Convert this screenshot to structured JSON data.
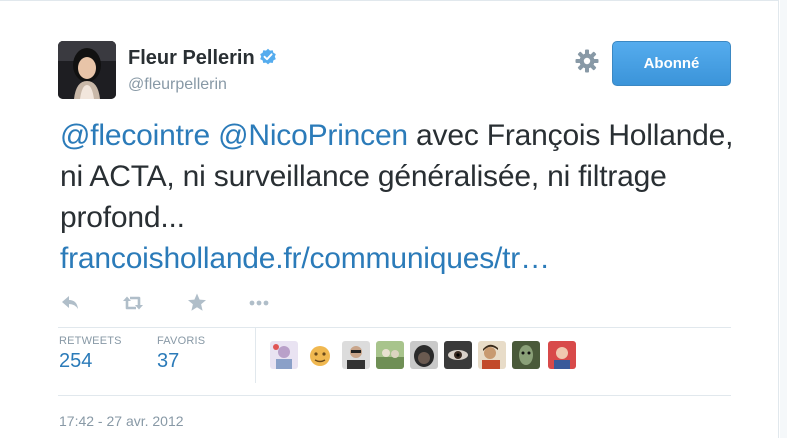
{
  "user": {
    "name": "Fleur Pellerin",
    "handle": "@fleurpellerin",
    "verified": true
  },
  "follow_button": {
    "label": "Abonné"
  },
  "tweet": {
    "mention_1": "@flecointre",
    "mention_2": "@NicoPrincen",
    "text_after_mentions": " avec François Hollande, ni ACTA, ni surveillance généralisée, ni filtrage profond...",
    "link_text": "francoishollande.fr/communiques/tr…"
  },
  "actions": [
    {
      "icon": "reply-icon"
    },
    {
      "icon": "retweet-icon"
    },
    {
      "icon": "favorite-star-icon"
    },
    {
      "icon": "more-dots-icon"
    }
  ],
  "stats": {
    "retweets": {
      "label": "RETWEETS",
      "value": "254"
    },
    "favorites": {
      "label": "FAVORIS",
      "value": "37"
    }
  },
  "timestamp": "17:42 - 27 avr. 2012",
  "colors": {
    "accent": "#55acee",
    "link": "#2b7bb9",
    "text": "#292f33",
    "muted": "#8899a6",
    "border": "#e1e8ed"
  }
}
